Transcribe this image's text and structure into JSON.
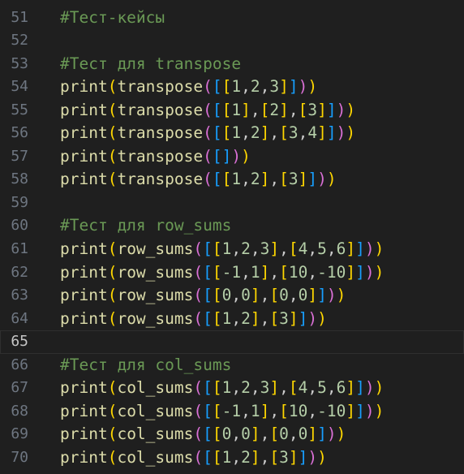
{
  "editor": {
    "theme_colors": {
      "background": "#1f1f1f",
      "line_number": "#6e7681",
      "line_number_active": "#c6c6c6",
      "comment": "#6a9955",
      "function": "#dcdcaa",
      "number": "#b5cea8",
      "punctuation": "#cccccc",
      "bracket_level_1": "#ffd700",
      "bracket_level_2": "#da70d6",
      "bracket_level_3": "#179fff"
    },
    "current_line": 65,
    "lines": [
      {
        "number": 51,
        "code": "#Тест-кейсы"
      },
      {
        "number": 52,
        "code": ""
      },
      {
        "number": 53,
        "code": "#Тест для transpose"
      },
      {
        "number": 54,
        "code": "print(transpose([[1,2,3]]))"
      },
      {
        "number": 55,
        "code": "print(transpose([[1],[2],[3]]))"
      },
      {
        "number": 56,
        "code": "print(transpose([[1,2],[3,4]]))"
      },
      {
        "number": 57,
        "code": "print(transpose([]))"
      },
      {
        "number": 58,
        "code": "print(transpose([[1,2],[3]]))"
      },
      {
        "number": 59,
        "code": ""
      },
      {
        "number": 60,
        "code": "#Тест для row_sums"
      },
      {
        "number": 61,
        "code": "print(row_sums([[1,2,3],[4,5,6]]))"
      },
      {
        "number": 62,
        "code": "print(row_sums([[-1,1],[10,-10]]))"
      },
      {
        "number": 63,
        "code": "print(row_sums([[0,0],[0,0]]))"
      },
      {
        "number": 64,
        "code": "print(row_sums([[1,2],[3]]))"
      },
      {
        "number": 65,
        "code": ""
      },
      {
        "number": 66,
        "code": "#Тест для col_sums"
      },
      {
        "number": 67,
        "code": "print(col_sums([[1,2,3],[4,5,6]]))"
      },
      {
        "number": 68,
        "code": "print(col_sums([[-1,1],[10,-10]]))"
      },
      {
        "number": 69,
        "code": "print(col_sums([[0,0],[0,0]]))"
      },
      {
        "number": 70,
        "code": "print(col_sums([[1,2],[3]]))"
      }
    ]
  }
}
